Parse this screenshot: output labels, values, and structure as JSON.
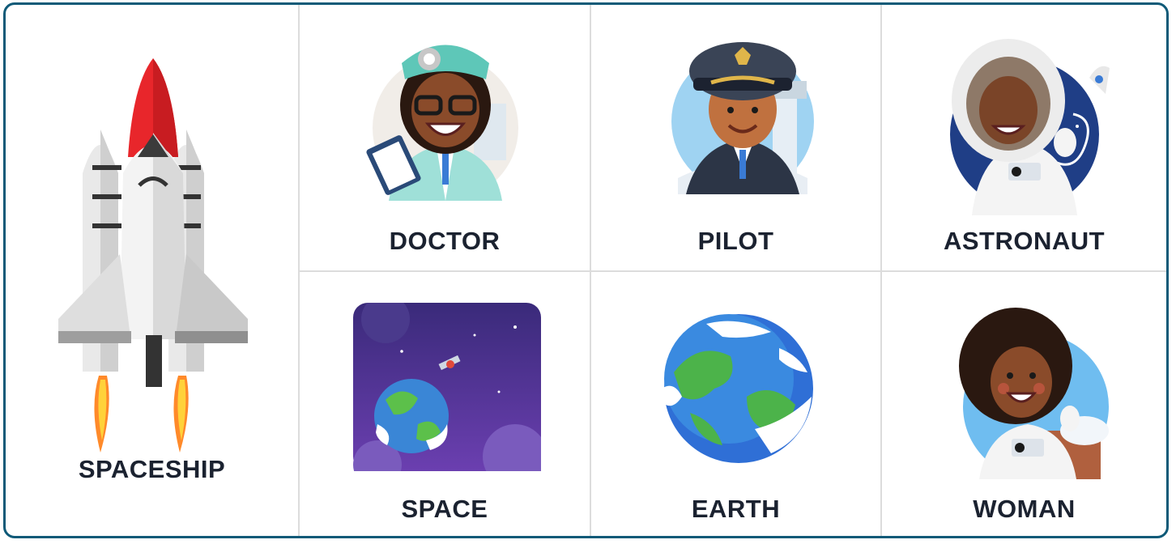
{
  "cards": {
    "spaceship": {
      "label": "SPACESHIP",
      "icon": "rocket-icon"
    },
    "doctor": {
      "label": "DOCTOR",
      "icon": "doctor-icon"
    },
    "pilot": {
      "label": "PILOT",
      "icon": "pilot-icon"
    },
    "astronaut": {
      "label": "ASTRONAUT",
      "icon": "astronaut-icon"
    },
    "space": {
      "label": "SPACE",
      "icon": "space-icon"
    },
    "earth": {
      "label": "EARTH",
      "icon": "earth-icon"
    },
    "woman": {
      "label": "WOMAN",
      "icon": "woman-icon"
    }
  },
  "colors": {
    "border": "#0f5a78",
    "text": "#1b2230",
    "divider": "#dcdcdc"
  }
}
